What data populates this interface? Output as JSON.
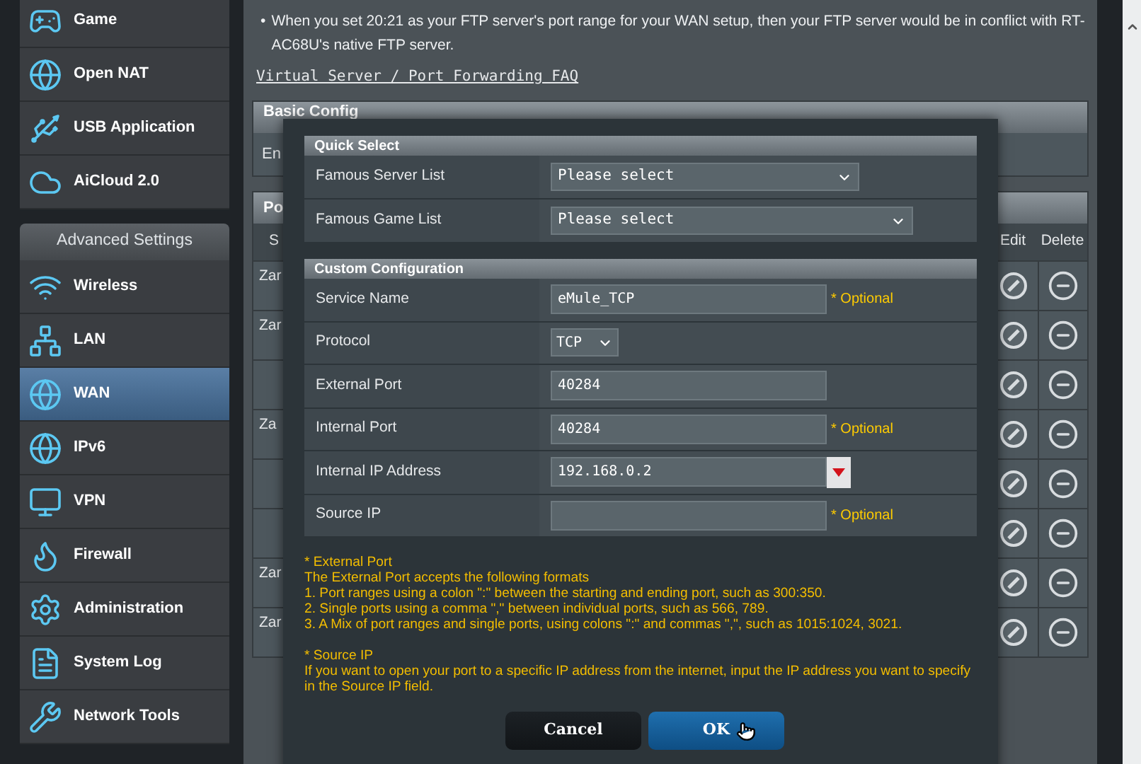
{
  "sidebar": {
    "top_items": [
      {
        "label": "Game",
        "selected": false
      },
      {
        "label": "Open NAT",
        "selected": false
      },
      {
        "label": "USB Application",
        "selected": false
      },
      {
        "label": "AiCloud 2.0",
        "selected": false
      }
    ],
    "advanced_header": "Advanced Settings",
    "advanced_items": [
      {
        "label": "Wireless",
        "selected": false
      },
      {
        "label": "LAN",
        "selected": false
      },
      {
        "label": "WAN",
        "selected": true
      },
      {
        "label": "IPv6",
        "selected": false
      },
      {
        "label": "VPN",
        "selected": false
      },
      {
        "label": "Firewall",
        "selected": false
      },
      {
        "label": "Administration",
        "selected": false
      },
      {
        "label": "System Log",
        "selected": false
      },
      {
        "label": "Network Tools",
        "selected": false
      }
    ]
  },
  "notice": {
    "bullet": "•",
    "text": "When you set 20:21 as your FTP server's port range for your WAN setup, then your FTP server would be in conflict with RT-AC68U's native FTP server.",
    "link": "Virtual Server / Port Forwarding FAQ"
  },
  "basic_config": {
    "title": "Basic Config",
    "row_label": "En"
  },
  "list_panel": {
    "title": "Po",
    "columns": [
      "S",
      "Edit",
      "Delete"
    ],
    "rows": [
      {
        "name": "Zar"
      },
      {
        "name": "Zar"
      },
      {},
      {
        "name": "Za"
      },
      {},
      {},
      {
        "name": "Zar"
      },
      {
        "name": "Zar"
      }
    ]
  },
  "modal": {
    "quick_select": {
      "title": "Quick Select",
      "rows": [
        {
          "label": "Famous Server List",
          "value": "Please select"
        },
        {
          "label": "Famous Game List",
          "value": "Please select"
        }
      ]
    },
    "custom": {
      "title": "Custom Configuration",
      "rows": [
        {
          "kind": "input",
          "label": "Service Name",
          "value": "eMule_TCP",
          "hint": "* Optional"
        },
        {
          "kind": "select",
          "label": "Protocol",
          "value": "TCP"
        },
        {
          "kind": "input",
          "label": "External Port",
          "value": "40284"
        },
        {
          "kind": "input",
          "label": "Internal Port",
          "value": "40284",
          "hint": "* Optional"
        },
        {
          "kind": "ip-select",
          "label": "Internal IP Address",
          "value": "192.168.0.2"
        },
        {
          "kind": "input",
          "label": "Source IP",
          "hint": "* Optional"
        }
      ]
    },
    "notes": [
      {
        "title": "* External Port",
        "lines": [
          "The External Port accepts the following formats",
          "1. Port ranges using a colon \":\" between the starting and ending port, such as 300:350.",
          "2. Single ports using a comma \",\" between individual ports, such as 566, 789.",
          "3. A Mix of port ranges and single ports, using colons \":\" and commas \",\", such as 1015:1024, 3021."
        ]
      },
      {
        "title": "* Source IP",
        "lines": [
          "If you want to open your port to a specific IP address from the internet, input the IP address you want to specify in the Source IP field."
        ]
      }
    ],
    "buttons": [
      {
        "label": "Cancel",
        "kind": "secondary"
      },
      {
        "label": "OK",
        "kind": "primary"
      }
    ]
  }
}
